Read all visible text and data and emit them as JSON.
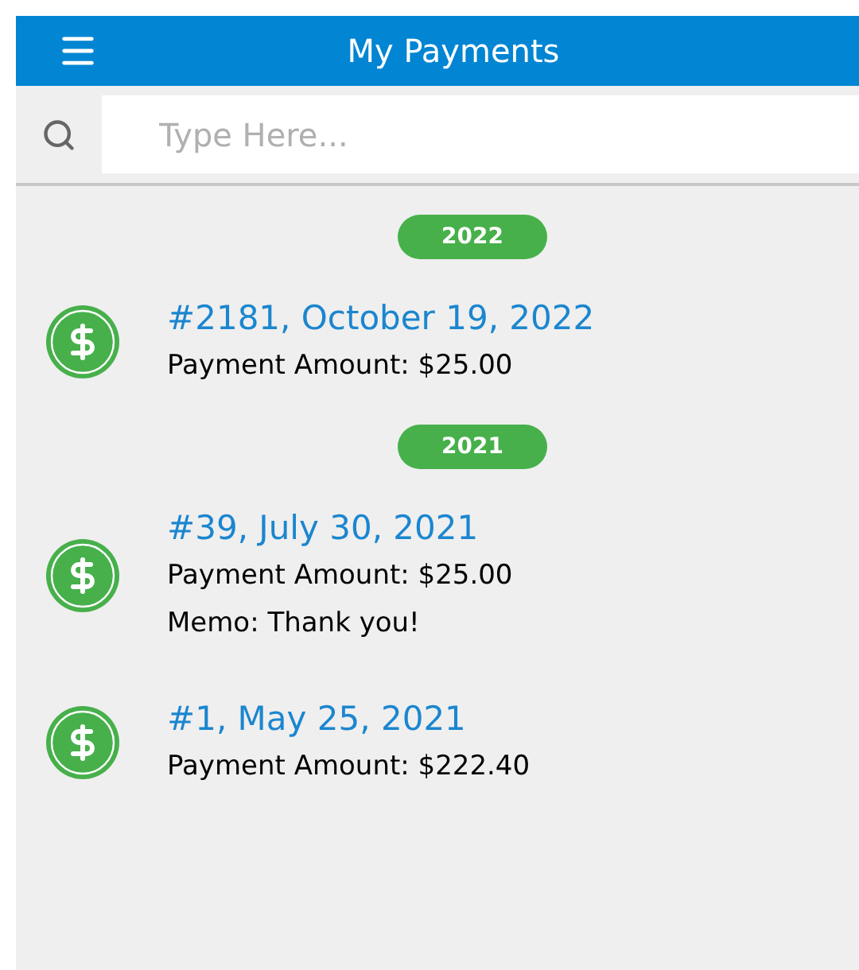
{
  "header": {
    "title": "My Payments"
  },
  "search": {
    "placeholder": "Type Here..."
  },
  "groups": [
    {
      "year": "2022",
      "payments": [
        {
          "title": "#2181, October 19, 2022",
          "lines": [
            "Payment Amount: $25.00"
          ]
        }
      ]
    },
    {
      "year": "2021",
      "payments": [
        {
          "title": "#39, July 30, 2021",
          "lines": [
            "Payment Amount: $25.00",
            "Memo: Thank you!"
          ]
        },
        {
          "title": "#1, May 25, 2021",
          "lines": [
            "Payment Amount: $222.40"
          ]
        }
      ]
    }
  ]
}
